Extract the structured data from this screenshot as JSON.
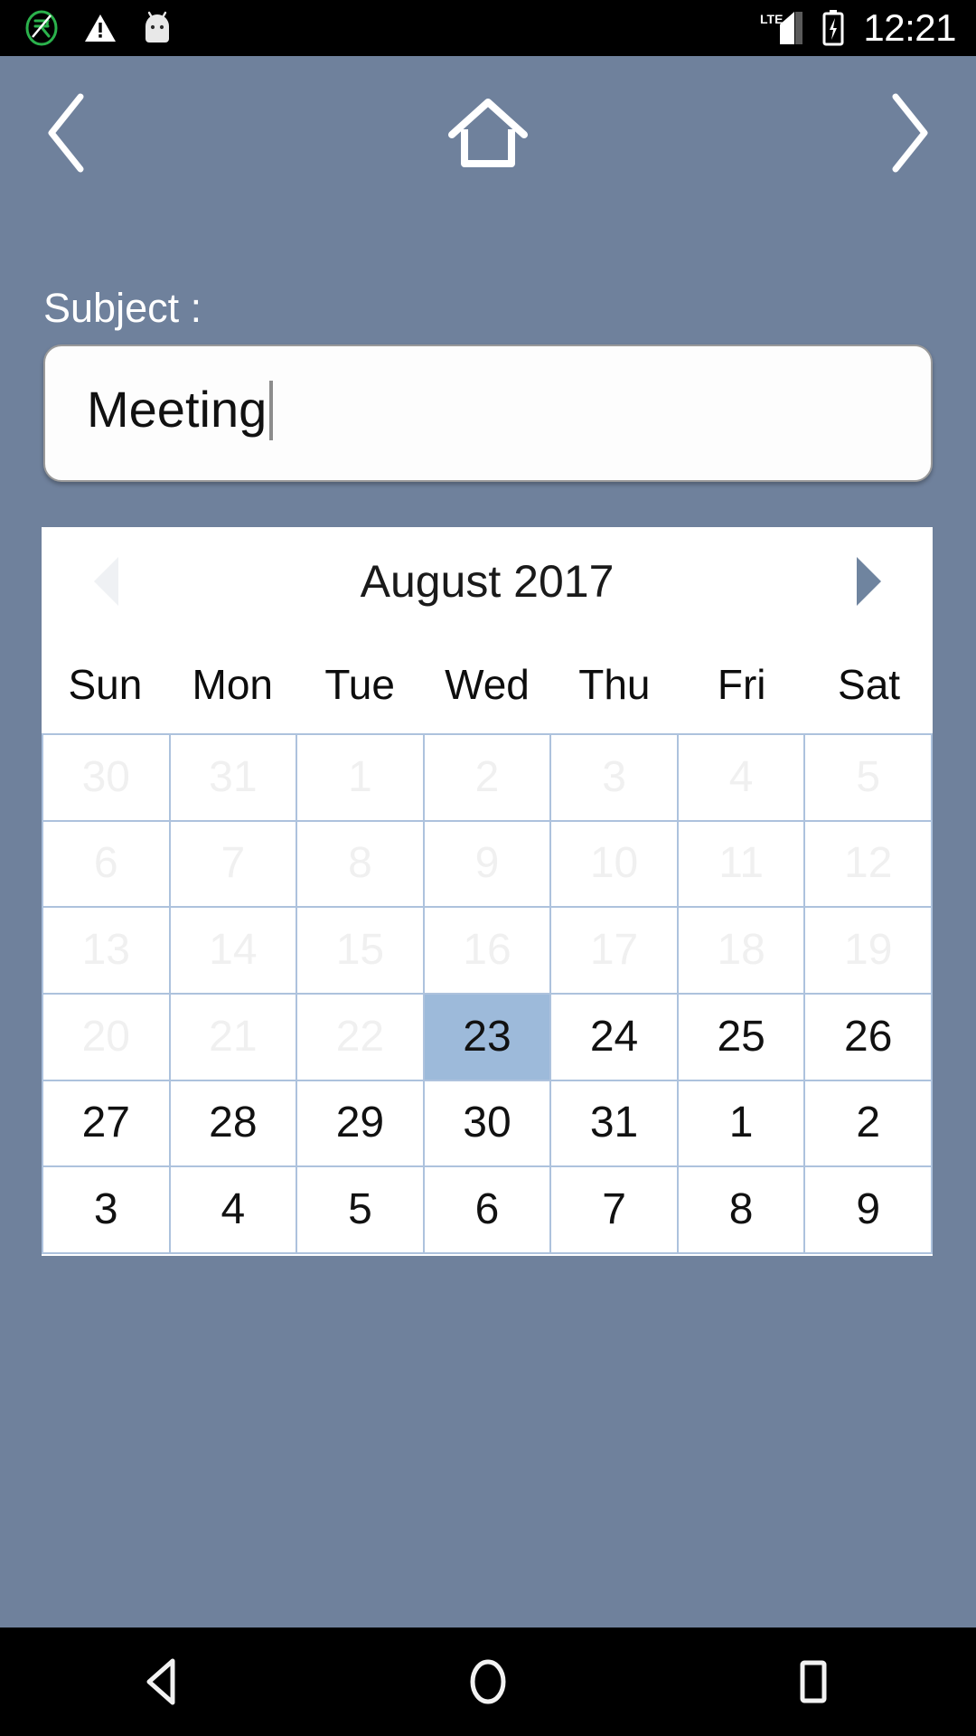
{
  "statusbar": {
    "icons": [
      "rupee-circle-icon",
      "warning-triangle-icon",
      "android-robot-icon"
    ],
    "network_label": "LTE",
    "battery_state": "charging",
    "time": "12:21"
  },
  "appnav": {
    "back_label": "back-chevron-icon",
    "home_label": "home-icon",
    "forward_label": "forward-chevron-icon"
  },
  "form": {
    "subject_label": "Subject :",
    "subject_value": "Meeting",
    "subject_placeholder": "Subject"
  },
  "calendar": {
    "title": "August 2017",
    "prev_label": "previous-month-arrow",
    "next_label": "next-month-arrow",
    "weekdays": [
      "Sun",
      "Mon",
      "Tue",
      "Wed",
      "Thu",
      "Fri",
      "Sat"
    ],
    "selected_day": "23",
    "cells": [
      {
        "d": "30",
        "s": "dim"
      },
      {
        "d": "31",
        "s": "dim"
      },
      {
        "d": "1",
        "s": "dim"
      },
      {
        "d": "2",
        "s": "dim"
      },
      {
        "d": "3",
        "s": "dim"
      },
      {
        "d": "4",
        "s": "dim"
      },
      {
        "d": "5",
        "s": "dim"
      },
      {
        "d": "6",
        "s": "dim"
      },
      {
        "d": "7",
        "s": "dim"
      },
      {
        "d": "8",
        "s": "dim"
      },
      {
        "d": "9",
        "s": "dim"
      },
      {
        "d": "10",
        "s": "dim"
      },
      {
        "d": "11",
        "s": "dim"
      },
      {
        "d": "12",
        "s": "dim"
      },
      {
        "d": "13",
        "s": "dim"
      },
      {
        "d": "14",
        "s": "dim"
      },
      {
        "d": "15",
        "s": "dim"
      },
      {
        "d": "16",
        "s": "dim"
      },
      {
        "d": "17",
        "s": "dim"
      },
      {
        "d": "18",
        "s": "dim"
      },
      {
        "d": "19",
        "s": "dim"
      },
      {
        "d": "20",
        "s": "dim"
      },
      {
        "d": "21",
        "s": "dim"
      },
      {
        "d": "22",
        "s": "dim"
      },
      {
        "d": "23",
        "s": "sel"
      },
      {
        "d": "24",
        "s": ""
      },
      {
        "d": "25",
        "s": ""
      },
      {
        "d": "26",
        "s": ""
      },
      {
        "d": "27",
        "s": ""
      },
      {
        "d": "28",
        "s": ""
      },
      {
        "d": "29",
        "s": ""
      },
      {
        "d": "30",
        "s": ""
      },
      {
        "d": "31",
        "s": ""
      },
      {
        "d": "1",
        "s": ""
      },
      {
        "d": "2",
        "s": ""
      },
      {
        "d": "3",
        "s": ""
      },
      {
        "d": "4",
        "s": ""
      },
      {
        "d": "5",
        "s": ""
      },
      {
        "d": "6",
        "s": ""
      },
      {
        "d": "7",
        "s": ""
      },
      {
        "d": "8",
        "s": ""
      },
      {
        "d": "9",
        "s": ""
      }
    ]
  },
  "sysnav": {
    "back": "back-triangle-icon",
    "home": "home-circle-icon",
    "recents": "recents-square-icon"
  },
  "colors": {
    "page_background": "#6f819c",
    "selected_day": "#9dbada",
    "grid_line": "#adc2dd",
    "dim_text": "#f0f0f0",
    "card_background": "#ffffff"
  }
}
